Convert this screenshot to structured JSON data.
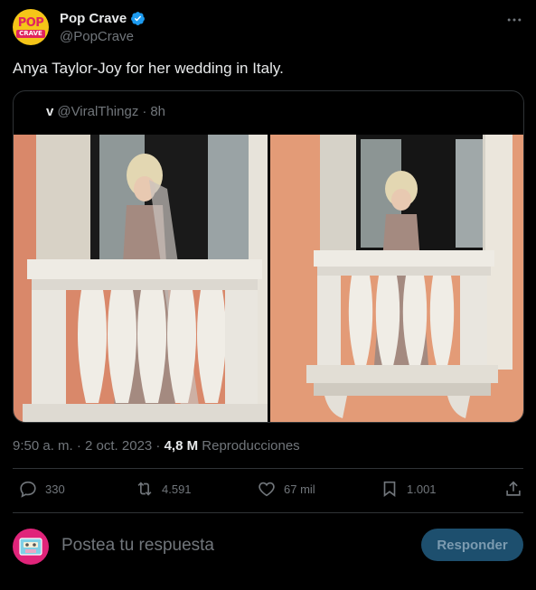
{
  "author": {
    "display_name": "Pop Crave",
    "handle": "@PopCrave",
    "avatar_text_top": "POP",
    "avatar_text_bottom": "CRAVE"
  },
  "tweet": {
    "text": "Anya Taylor-Joy for her wedding in Italy."
  },
  "quoted": {
    "name": "v",
    "handle": "@ViralThingz",
    "time": "8h"
  },
  "meta": {
    "timestamp": "9:50 a. m. · 2 oct. 2023 · ",
    "views_count": "4,8 M",
    "views_label": " Reproducciones"
  },
  "actions": {
    "replies": "330",
    "reposts": "4.591",
    "likes": "67 mil",
    "bookmarks": "1.001"
  },
  "reply": {
    "placeholder": "Postea tu respuesta",
    "button": "Responder"
  },
  "icons": {
    "verified": "verified-badge-icon",
    "more": "more-icon",
    "reply": "reply-icon",
    "repost": "repost-icon",
    "like": "like-icon",
    "bookmark": "bookmark-icon",
    "share": "share-icon"
  },
  "colors": {
    "background": "#000000",
    "accent": "#1d9bf0",
    "muted": "#71767b"
  }
}
